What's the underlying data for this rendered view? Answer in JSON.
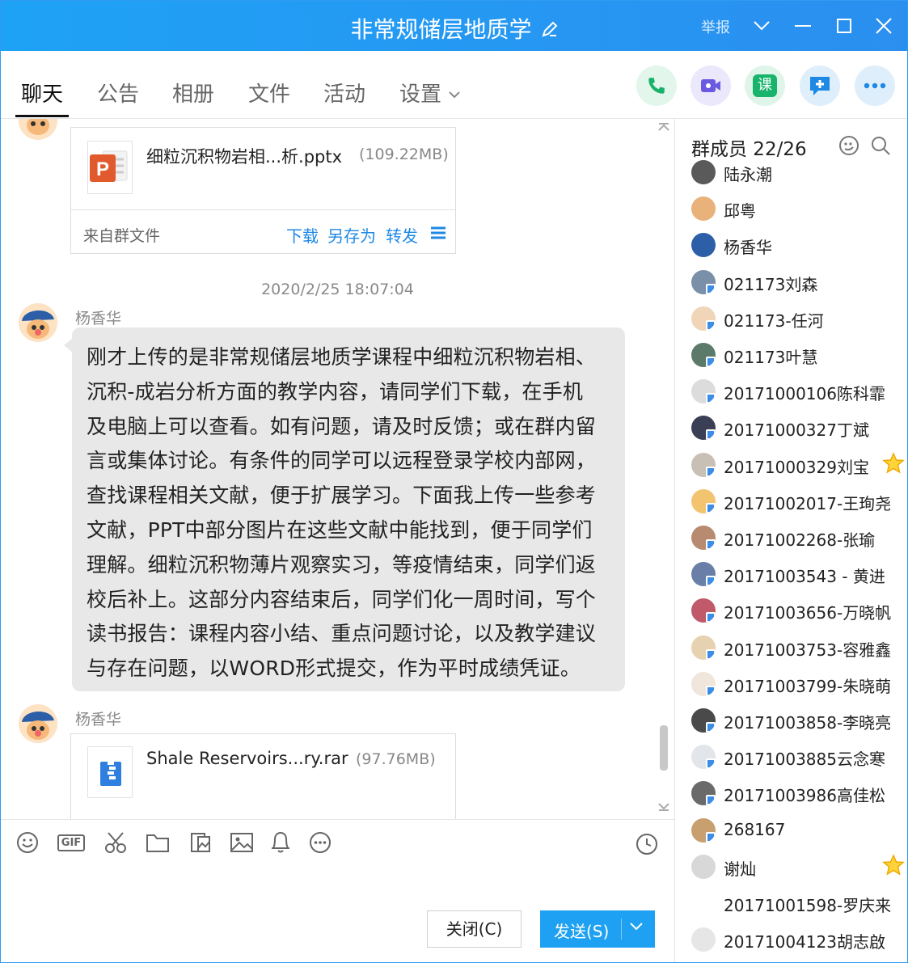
{
  "window": {
    "title": "非常规储层地质学",
    "report": "举报"
  },
  "tabs": [
    {
      "label": "聊天",
      "active": true
    },
    {
      "label": "公告"
    },
    {
      "label": "相册"
    },
    {
      "label": "文件"
    },
    {
      "label": "活动"
    },
    {
      "label": "设置"
    }
  ],
  "toolbar_right": [
    "phone-icon",
    "video-icon",
    "course-icon",
    "add-message-icon",
    "more-icon"
  ],
  "course_icon_char": "课",
  "chat": {
    "file1": {
      "name": "细粒沉积物岩相...析.pptx",
      "size": "(109.22MB)",
      "from": "来自群文件",
      "actions": [
        "下载",
        "另存为",
        "转发"
      ]
    },
    "timestamp": "2020/2/25 18:07:04",
    "message1": {
      "sender": "杨香华",
      "lines": [
        "刚才上传的是非常规储层地质学课程中细粒沉积物岩相、",
        "沉积-成岩分析方面的教学内容，请同学们下载，在手机",
        "及电脑上可以查看。如有问题，请及时反馈；或在群内留",
        "言或集体讨论。有条件的同学可以远程登录学校内部网，",
        "查找课程相关文献，便于扩展学习。下面我上传一些参考",
        "文献，PPT中部分图片在这些文献中能找到，便于同学们",
        "理解。细粒沉积物薄片观察实习，等疫情结束，同学们返",
        "校后补上。这部分内容结束后，同学们化一周时间，写个",
        "读书报告：课程内容小结、重点问题讨论，以及教学建议",
        "与存在问题，以WORD形式提交，作为平时成绩凭证。"
      ]
    },
    "message2": {
      "sender": "杨香华",
      "file": {
        "name": "Shale Reservoirs...ry.rar",
        "size": "(97.76MB)"
      }
    }
  },
  "input": {
    "tools": [
      "emoji-icon",
      "gif-icon",
      "screenshot-scissors-icon",
      "folder-icon",
      "image-file-icon",
      "picture-icon",
      "bell-icon",
      "more-circle-icon"
    ],
    "gif_text": "GIF",
    "close_button": "关闭(C)",
    "send_button": "发送(S)"
  },
  "members": {
    "title": "群成员 22/26",
    "list": [
      {
        "name": "陆永潮",
        "color": "#5a5a5a",
        "device": false
      },
      {
        "name": "邱粤",
        "color": "#e8b27a",
        "device": false
      },
      {
        "name": "杨香华",
        "color": "#2c5fa8",
        "device": false
      },
      {
        "name": "021173刘森",
        "color": "#7a8fa8",
        "device": true
      },
      {
        "name": "021173-任河",
        "color": "#f0d5b8",
        "device": true
      },
      {
        "name": "021173叶慧",
        "color": "#5c7a6a",
        "device": true
      },
      {
        "name": "20171000106陈科霏",
        "color": "#dcdcdc",
        "device": true
      },
      {
        "name": "20171000327丁斌",
        "color": "#3a3f55",
        "device": true
      },
      {
        "name": "20171000329刘宝",
        "color": "#c8c0b5",
        "device": true,
        "star": true
      },
      {
        "name": "20171002017-王珣尧",
        "color": "#f2c470",
        "device": true
      },
      {
        "name": "20171002268-张瑜",
        "color": "#b88a70",
        "device": true
      },
      {
        "name": "20171003543 - 黄进",
        "color": "#6a7fa8",
        "device": true
      },
      {
        "name": "20171003656-万晓帆",
        "color": "#c05a6a",
        "device": true
      },
      {
        "name": "20171003753-容雅鑫",
        "color": "#e6d2b0",
        "device": true
      },
      {
        "name": "20171003799-朱晓萌",
        "color": "#f0e6dc",
        "device": true
      },
      {
        "name": "20171003858-李晓亮",
        "color": "#4a4a4a",
        "device": true
      },
      {
        "name": "20171003885云念寒",
        "color": "#e2e6ea",
        "device": true
      },
      {
        "name": "20171003986高佳松",
        "color": "#6a6a6a",
        "device": true
      },
      {
        "name": "268167",
        "color": "#c8a070",
        "device": true
      },
      {
        "name": "谢灿",
        "color": "#d8d8d8",
        "device": false,
        "star": true
      },
      {
        "name": "20171001598-罗庆来",
        "color": "#ffffff",
        "device": false
      },
      {
        "name": "20171004123胡志啟",
        "color": "#e6e6e6",
        "device": false
      }
    ]
  },
  "colors": {
    "accent": "#1e88e5",
    "titlebar": "#1ea2f5",
    "send": "#1ea1f2"
  }
}
